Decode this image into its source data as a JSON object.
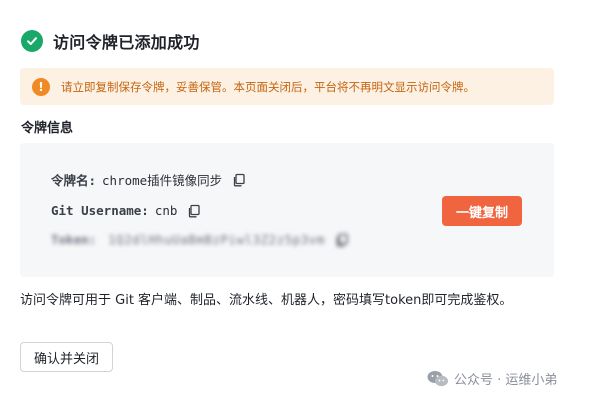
{
  "dialog": {
    "title": "访问令牌已添加成功",
    "warning": "请立即复制保存令牌，妥善保管。本页面关闭后，平台将不再明文显示访问令牌。",
    "section_label": "令牌信息",
    "usage_note": "访问令牌可用于 Git 客户端、制品、流水线、机器人，密码填写token即可完成鉴权。",
    "confirm_label": "确认并关闭"
  },
  "token_info": {
    "name_label": "令牌名:",
    "name_value": "chrome插件镜像同步",
    "username_label": "Git Username:",
    "username_value": "cnb",
    "token_label": "Token:",
    "token_value": "1Q2dlHhuUaBmBzPiwl3Z2z5p3vm",
    "copy_all_label": "一键复制"
  },
  "watermark": {
    "text": "公众号 · 运维小弟"
  },
  "colors": {
    "success": "#1aa868",
    "warning": "#f08a24",
    "accent": "#f0643f"
  }
}
